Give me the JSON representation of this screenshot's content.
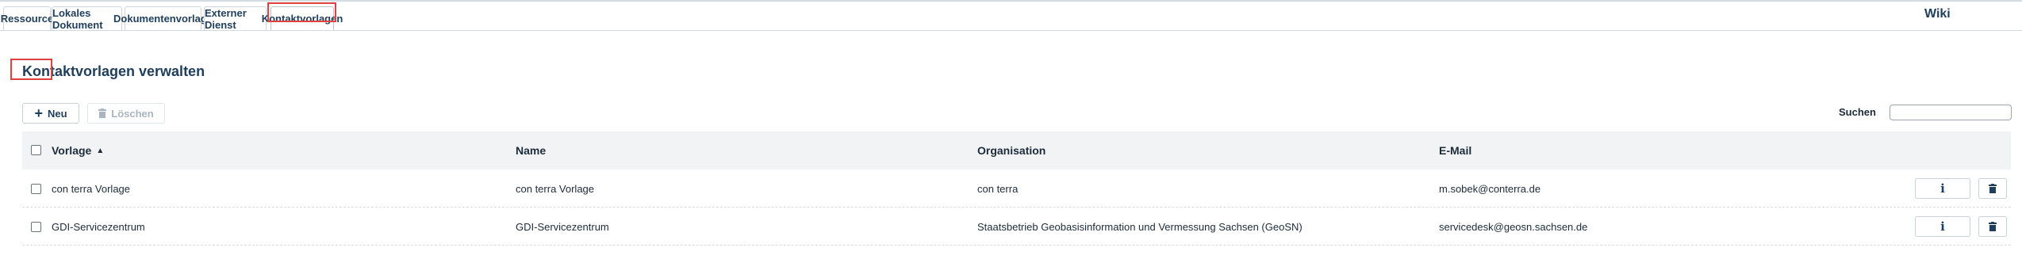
{
  "tabs": [
    {
      "label": "Ressource"
    },
    {
      "label": "Lokales Dokument"
    },
    {
      "label": "Dokumentenvorlage"
    },
    {
      "label": "Externer Dienst"
    },
    {
      "label": "Kontaktvorlagen",
      "active": true
    }
  ],
  "header": {
    "wiki_label": "Wiki"
  },
  "page": {
    "title": "Kontaktvorlagen verwalten"
  },
  "toolbar": {
    "new_label": "Neu",
    "new_icon": "plus-icon",
    "delete_label": "Löschen",
    "delete_icon": "trash-icon",
    "delete_disabled": true
  },
  "search": {
    "label": "Suchen",
    "value": ""
  },
  "table": {
    "columns": [
      "Vorlage",
      "Name",
      "Organisation",
      "E-Mail"
    ],
    "sort": {
      "column": "Vorlage",
      "direction": "ascending"
    },
    "rows": [
      {
        "vorlage": "con terra Vorlage",
        "name": "con terra Vorlage",
        "organisation": "con terra",
        "email": "m.sobek@conterra.de"
      },
      {
        "vorlage": "GDI-Servicezentrum",
        "name": "GDI-Servicezentrum",
        "organisation": "Staatsbetrieb Geobasisinformation und Vermessung Sachsen (GeoSN)",
        "email": "servicedesk@geosn.sachsen.de"
      }
    ],
    "row_actions": {
      "info_icon": "info-icon",
      "delete_icon": "trash-icon"
    }
  },
  "colors": {
    "text_dark": "#1c2b3a",
    "title_blue": "#1f3e5c",
    "header_bg": "#f2f3f5",
    "highlight_red": "#e04040",
    "disabled_gray": "#a9b6c2"
  }
}
